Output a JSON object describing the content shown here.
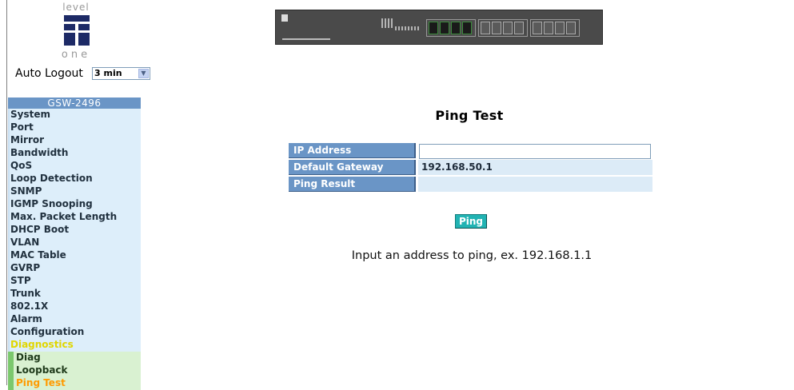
{
  "logo": {
    "top_text": "level",
    "bottom_text": "one",
    "mark_color": "#1d2a66"
  },
  "auto_logout": {
    "label": "Auto Logout",
    "selected": "3 min"
  },
  "menu": {
    "title": "GSW-2496",
    "items": [
      {
        "label": "System"
      },
      {
        "label": "Port"
      },
      {
        "label": "Mirror"
      },
      {
        "label": "Bandwidth"
      },
      {
        "label": "QoS"
      },
      {
        "label": "Loop Detection"
      },
      {
        "label": "SNMP"
      },
      {
        "label": "IGMP Snooping"
      },
      {
        "label": "Max. Packet Length"
      },
      {
        "label": "DHCP Boot"
      },
      {
        "label": "VLAN"
      },
      {
        "label": "MAC Table"
      },
      {
        "label": "GVRP"
      },
      {
        "label": "STP"
      },
      {
        "label": "Trunk"
      },
      {
        "label": "802.1X"
      },
      {
        "label": "Alarm"
      },
      {
        "label": "Configuration"
      },
      {
        "label": "Diagnostics"
      }
    ],
    "subitems": [
      {
        "label": "Diag"
      },
      {
        "label": "Loopback"
      },
      {
        "label": "Ping Test"
      }
    ],
    "colors": {
      "header": "#6a95c6",
      "item_bg": "#ddeefa",
      "active": "#e0d600",
      "current": "#ff9a00"
    }
  },
  "main": {
    "title": "Ping Test",
    "form": {
      "ip_address_label": "IP Address",
      "ip_address_value": "",
      "gateway_label": "Default Gateway",
      "gateway_value": "192.168.50.1",
      "result_label": "Ping Result",
      "result_value": ""
    },
    "ping_button": "Ping",
    "hint": "Input an address to ping, ex. 192.168.1.1"
  }
}
